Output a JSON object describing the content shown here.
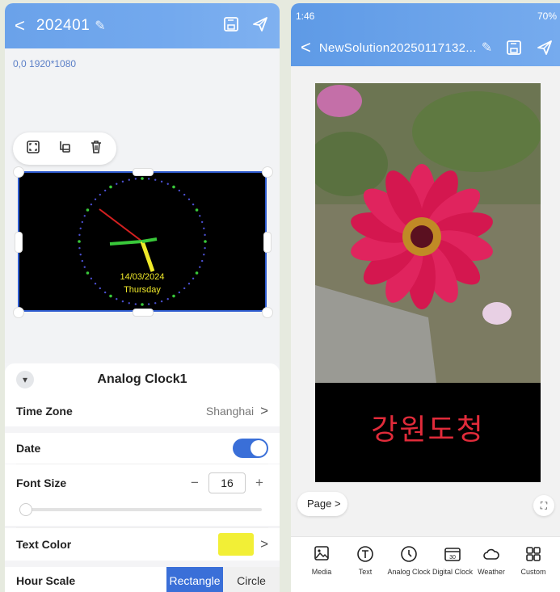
{
  "left": {
    "header": {
      "title": "202401",
      "back_icon": "chevron-left-icon",
      "edit_icon": "pencil-icon",
      "save_icon": "save-icon",
      "send_icon": "send-icon"
    },
    "canvas": {
      "resolution": "0,0 1920*1080"
    },
    "clock": {
      "date": "14/03/2024",
      "day": "Thursday"
    },
    "panel": {
      "title": "Analog Clock1",
      "time_zone": {
        "label": "Time Zone",
        "value": "Shanghai"
      },
      "date": {
        "label": "Date",
        "enabled": true
      },
      "font_size": {
        "label": "Font Size",
        "value": "16",
        "minus": "−",
        "plus": "+"
      },
      "text_color": {
        "label": "Text Color",
        "color": "#f2ef36"
      },
      "hour_scale": {
        "label": "Hour Scale",
        "options": [
          "Rectangle",
          "Circle"
        ],
        "selected": "Rectangle"
      }
    }
  },
  "right": {
    "status_bar": {
      "time": "1:46",
      "battery": "70%"
    },
    "header": {
      "title": "NewSolution20250117132...",
      "back_icon": "chevron-left-icon"
    },
    "preview": {
      "text": "강원도청"
    },
    "page_button": "Page >",
    "dock": [
      {
        "label": "Media",
        "icon": "media-icon"
      },
      {
        "label": "Text",
        "icon": "text-icon"
      },
      {
        "label": "Analog Clock",
        "icon": "analog-clock-icon"
      },
      {
        "label": "Digital Clock",
        "icon": "digital-clock-icon"
      },
      {
        "label": "Weather",
        "icon": "weather-icon"
      },
      {
        "label": "Custom",
        "icon": "custom-icon"
      }
    ]
  },
  "colors": {
    "accent": "#3a6fd8",
    "header": "#6aa2ea",
    "korean_text": "#e12b3a"
  }
}
